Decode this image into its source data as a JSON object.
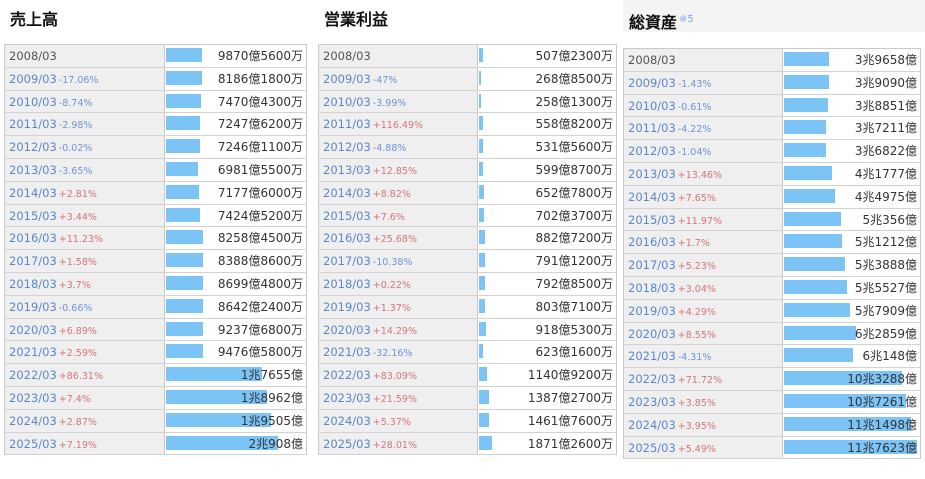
{
  "panels": [
    {
      "title": "売上高",
      "footnote": "",
      "rows": [
        {
          "year": "2008/03",
          "change": "",
          "dir": "",
          "value": "9870億5600万",
          "frac": 0.262
        },
        {
          "year": "2009/03",
          "change": "-17.06%",
          "dir": "neg",
          "value": "8186億1800万",
          "frac": 0.266
        },
        {
          "year": "2010/03",
          "change": "-8.74%",
          "dir": "neg",
          "value": "7470億4300万",
          "frac": 0.255
        },
        {
          "year": "2011/03",
          "change": "-2.98%",
          "dir": "neg",
          "value": "7247億6200万",
          "frac": 0.245
        },
        {
          "year": "2012/03",
          "change": "-0.02%",
          "dir": "neg",
          "value": "7246億1100万",
          "frac": 0.245
        },
        {
          "year": "2013/03",
          "change": "-3.65%",
          "dir": "neg",
          "value": "6981億5500万",
          "frac": 0.235
        },
        {
          "year": "2014/03",
          "change": "+2.81%",
          "dir": "pos",
          "value": "7177億6000万",
          "frac": 0.242
        },
        {
          "year": "2015/03",
          "change": "+3.44%",
          "dir": "pos",
          "value": "7424億5200万",
          "frac": 0.25
        },
        {
          "year": "2016/03",
          "change": "+11.23%",
          "dir": "pos",
          "value": "8258億4500万",
          "frac": 0.268
        },
        {
          "year": "2017/03",
          "change": "+1.58%",
          "dir": "pos",
          "value": "8388億8600万",
          "frac": 0.268
        },
        {
          "year": "2018/03",
          "change": "+3.7%",
          "dir": "pos",
          "value": "8699億4800万",
          "frac": 0.268
        },
        {
          "year": "2019/03",
          "change": "-0.66%",
          "dir": "neg",
          "value": "8642億2400万",
          "frac": 0.268
        },
        {
          "year": "2020/03",
          "change": "+6.89%",
          "dir": "pos",
          "value": "9237億6800万",
          "frac": 0.268
        },
        {
          "year": "2021/03",
          "change": "+2.59%",
          "dir": "pos",
          "value": "9476億5800万",
          "frac": 0.268
        },
        {
          "year": "2022/03",
          "change": "+86.31%",
          "dir": "pos",
          "value": "1兆7655億",
          "frac": 0.7
        },
        {
          "year": "2023/03",
          "change": "+7.4%",
          "dir": "pos",
          "value": "1兆8962億",
          "frac": 0.74
        },
        {
          "year": "2024/03",
          "change": "+2.87%",
          "dir": "pos",
          "value": "1兆9505億",
          "frac": 0.77
        },
        {
          "year": "2025/03",
          "change": "+7.19%",
          "dir": "pos",
          "value": "2兆908億",
          "frac": 0.82
        }
      ]
    },
    {
      "title": "営業利益",
      "footnote": "",
      "rows": [
        {
          "year": "2008/03",
          "change": "",
          "dir": "",
          "value": "507億2300万",
          "frac": 0.027
        },
        {
          "year": "2009/03",
          "change": "-47%",
          "dir": "neg",
          "value": "268億8500万",
          "frac": 0.014
        },
        {
          "year": "2010/03",
          "change": "-3.99%",
          "dir": "neg",
          "value": "258億1300万",
          "frac": 0.014
        },
        {
          "year": "2011/03",
          "change": "+116.49%",
          "dir": "pos",
          "value": "558億8200万",
          "frac": 0.03
        },
        {
          "year": "2012/03",
          "change": "-4.88%",
          "dir": "neg",
          "value": "531億5600万",
          "frac": 0.028
        },
        {
          "year": "2013/03",
          "change": "+12.85%",
          "dir": "pos",
          "value": "599億8700万",
          "frac": 0.032
        },
        {
          "year": "2014/03",
          "change": "+8.82%",
          "dir": "pos",
          "value": "652億7800万",
          "frac": 0.035
        },
        {
          "year": "2015/03",
          "change": "+7.6%",
          "dir": "pos",
          "value": "702億3700万",
          "frac": 0.037
        },
        {
          "year": "2016/03",
          "change": "+25.68%",
          "dir": "pos",
          "value": "882億7200万",
          "frac": 0.047
        },
        {
          "year": "2017/03",
          "change": "-10.38%",
          "dir": "neg",
          "value": "791億1200万",
          "frac": 0.042
        },
        {
          "year": "2018/03",
          "change": "+0.22%",
          "dir": "pos",
          "value": "792億8500万",
          "frac": 0.042
        },
        {
          "year": "2019/03",
          "change": "+1.37%",
          "dir": "pos",
          "value": "803億7100万",
          "frac": 0.043
        },
        {
          "year": "2020/03",
          "change": "+14.29%",
          "dir": "pos",
          "value": "918億5300万",
          "frac": 0.049
        },
        {
          "year": "2021/03",
          "change": "-32.16%",
          "dir": "neg",
          "value": "623億1600万",
          "frac": 0.033
        },
        {
          "year": "2022/03",
          "change": "+83.09%",
          "dir": "pos",
          "value": "1140億9200万",
          "frac": 0.061
        },
        {
          "year": "2023/03",
          "change": "+21.59%",
          "dir": "pos",
          "value": "1387億2700万",
          "frac": 0.074
        },
        {
          "year": "2024/03",
          "change": "+5.37%",
          "dir": "pos",
          "value": "1461億7600万",
          "frac": 0.078
        },
        {
          "year": "2025/03",
          "change": "+28.01%",
          "dir": "pos",
          "value": "1871億2600万",
          "frac": 0.1
        }
      ]
    },
    {
      "title": "総資産",
      "footnote": "※5",
      "rows": [
        {
          "year": "2008/03",
          "change": "",
          "dir": "",
          "value": "3兆9658億",
          "frac": 0.34
        },
        {
          "year": "2009/03",
          "change": "-1.43%",
          "dir": "neg",
          "value": "3兆9090億",
          "frac": 0.335
        },
        {
          "year": "2010/03",
          "change": "-0.61%",
          "dir": "neg",
          "value": "3兆8851億",
          "frac": 0.333
        },
        {
          "year": "2011/03",
          "change": "-4.22%",
          "dir": "neg",
          "value": "3兆7211億",
          "frac": 0.319
        },
        {
          "year": "2012/03",
          "change": "-1.04%",
          "dir": "neg",
          "value": "3兆6822億",
          "frac": 0.316
        },
        {
          "year": "2013/03",
          "change": "+13.46%",
          "dir": "pos",
          "value": "4兆1777億",
          "frac": 0.358
        },
        {
          "year": "2014/03",
          "change": "+7.65%",
          "dir": "pos",
          "value": "4兆4975億",
          "frac": 0.386
        },
        {
          "year": "2015/03",
          "change": "+11.97%",
          "dir": "pos",
          "value": "5兆356億",
          "frac": 0.432
        },
        {
          "year": "2016/03",
          "change": "+1.7%",
          "dir": "pos",
          "value": "5兆1212億",
          "frac": 0.439
        },
        {
          "year": "2017/03",
          "change": "+5.23%",
          "dir": "pos",
          "value": "5兆3888億",
          "frac": 0.462
        },
        {
          "year": "2018/03",
          "change": "+3.04%",
          "dir": "pos",
          "value": "5兆5527億",
          "frac": 0.476
        },
        {
          "year": "2019/03",
          "change": "+4.29%",
          "dir": "pos",
          "value": "5兆7909億",
          "frac": 0.497
        },
        {
          "year": "2020/03",
          "change": "+8.55%",
          "dir": "pos",
          "value": "6兆2859億",
          "frac": 0.539
        },
        {
          "year": "2021/03",
          "change": "-4.31%",
          "dir": "neg",
          "value": "6兆148億",
          "frac": 0.516
        },
        {
          "year": "2022/03",
          "change": "+71.72%",
          "dir": "pos",
          "value": "10兆3288億",
          "frac": 0.886
        },
        {
          "year": "2023/03",
          "change": "+3.85%",
          "dir": "pos",
          "value": "10兆7261億",
          "frac": 0.92
        },
        {
          "year": "2024/03",
          "change": "+3.95%",
          "dir": "pos",
          "value": "11兆1498億",
          "frac": 0.956
        },
        {
          "year": "2025/03",
          "change": "+5.49%",
          "dir": "pos",
          "value": "11兆7623億",
          "frac": 1.0
        }
      ]
    }
  ]
}
